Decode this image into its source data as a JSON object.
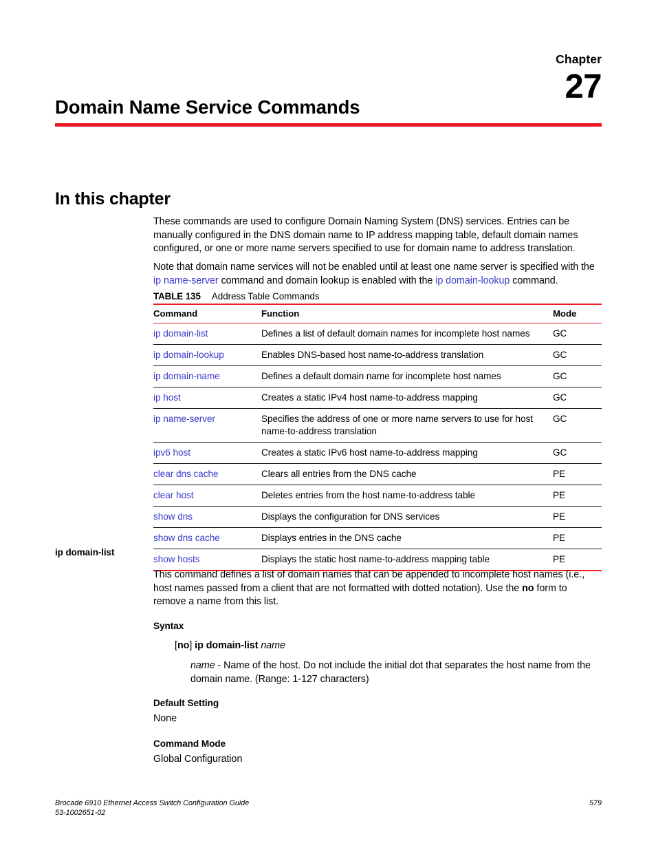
{
  "chapter": {
    "label": "Chapter",
    "number": "27",
    "title": "Domain Name Service Commands",
    "rule_color": "#ED1C24"
  },
  "section": {
    "heading": "In this chapter",
    "paragraph1": "These commands are used to configure Domain Naming System (DNS) services. Entries can be manually configured in the DNS domain name to IP address mapping table, default domain names configured, or one or more name servers specified to use for domain name to address translation.",
    "paragraph2_part1": "Note that domain name services will not be enabled until at least one name server is specified with the ",
    "paragraph2_link1": "ip name-server",
    "paragraph2_part2": " command and domain lookup is enabled with the ",
    "paragraph2_link2": "ip domain-lookup",
    "paragraph2_part3": " command."
  },
  "table": {
    "number": "TABLE 135",
    "title": "Address Table Commands",
    "columns": [
      "Command",
      "Function",
      "Mode"
    ],
    "rows": [
      {
        "command": "ip domain-list",
        "function": "Defines a list of default domain names for incomplete host names",
        "mode": "GC"
      },
      {
        "command": "ip domain-lookup",
        "function": "Enables DNS-based host name-to-address translation",
        "mode": "GC"
      },
      {
        "command": "ip domain-name",
        "function": "Defines a default domain name for incomplete host names",
        "mode": "GC"
      },
      {
        "command": "ip host",
        "function": "Creates a static IPv4 host name-to-address mapping",
        "mode": "GC"
      },
      {
        "command": "ip name-server",
        "function": "Specifies the address of one or more name servers to use for host name-to-address translation",
        "mode": "GC"
      },
      {
        "command": "ipv6 host",
        "function": "Creates a static IPv6 host name-to-address mapping",
        "mode": "GC"
      },
      {
        "command": "clear dns cache",
        "function": "Clears all entries from the DNS cache",
        "mode": "PE"
      },
      {
        "command": "clear host",
        "function": "Deletes entries from the host name-to-address table",
        "mode": "PE"
      },
      {
        "command": "show dns",
        "function": "Displays the configuration for DNS services",
        "mode": "PE"
      },
      {
        "command": "show dns cache",
        "function": "Displays entries in the DNS cache",
        "mode": "PE"
      },
      {
        "command": "show hosts",
        "function": "Displays the static host name-to-address mapping table",
        "mode": "PE"
      }
    ]
  },
  "command_entry": {
    "name": "ip domain-list",
    "description_part1": "This command defines a list of domain names that can be appended to incomplete host names (i.e., host names passed from a client that are not formatted with dotted notation). Use the ",
    "description_bold": "no",
    "description_part2": " form to remove a name from this list.",
    "syntax_heading": "Syntax",
    "syntax_bracket_open": "[",
    "syntax_no": "no",
    "syntax_bracket_close": "] ",
    "syntax_command": "ip domain-list",
    "syntax_arg": "name",
    "arg_name": "name",
    "arg_description": " - Name of the host. Do not include the initial dot that separates the host name from the domain name. (Range: 1-127 characters)",
    "default_heading": "Default Setting",
    "default_value": "None",
    "mode_heading": "Command Mode",
    "mode_value": "Global Configuration"
  },
  "footer": {
    "guide_title": "Brocade 6910 Ethernet Access Switch Configuration Guide",
    "doc_number": "53-1002651-02",
    "page_number": "579"
  },
  "colors": {
    "accent_red": "#ED1C24",
    "link_blue": "#3A3ACB"
  }
}
